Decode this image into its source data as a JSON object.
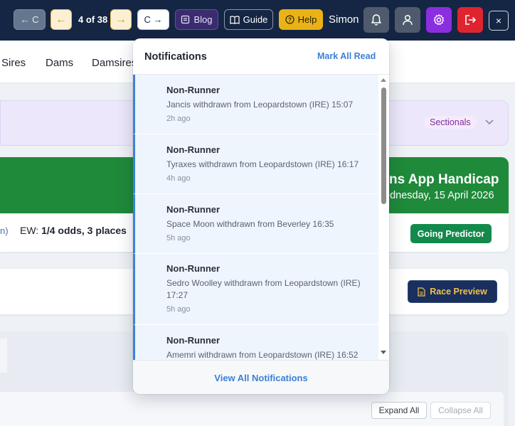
{
  "topbar": {
    "prev_label": "← C",
    "left_arrow": "←",
    "nav_count": "4 of 38",
    "right_arrow": "→",
    "next_label": "C →",
    "blog_label": "Blog",
    "guide_label": "Guide",
    "help_label": "Help",
    "user_name": "Simon",
    "close_label": "×",
    "icons": [
      "bell-icon",
      "user-icon",
      "gear-icon",
      "logout-icon",
      "close-icon"
    ]
  },
  "tabs": [
    "Sires",
    "Dams",
    "Damsires"
  ],
  "sectionals_badge": "Sectionals",
  "race": {
    "title": "ns App Handicap",
    "date": "ednesday, 15 April 2026",
    "meta_start": "n)",
    "ew_label": "EW: ",
    "ew_value": "1/4 odds, 3 places",
    "going_button": "Going Predictor"
  },
  "preview_button": "Race Preview",
  "expand_all": "Expand All",
  "collapse_all": "Collapse All",
  "notifications": {
    "title": "Notifications",
    "mark_all_read": "Mark All Read",
    "view_all": "View All Notifications",
    "items": [
      {
        "title": "Non-Runner",
        "message": "Jancis withdrawn from Leopardstown (IRE) 15:07",
        "time": "2h ago"
      },
      {
        "title": "Non-Runner",
        "message": "Tyraxes withdrawn from Leopardstown (IRE) 16:17",
        "time": "4h ago"
      },
      {
        "title": "Non-Runner",
        "message": "Space Moon withdrawn from Beverley 16:35",
        "time": "5h ago"
      },
      {
        "title": "Non-Runner",
        "message": "Sedro Woolley withdrawn from Leopardstown (IRE) 17:27",
        "time": "5h ago"
      },
      {
        "title": "Non-Runner",
        "message": "Amemri withdrawn from Leopardstown (IRE) 16:52",
        "time": ""
      }
    ]
  },
  "colors": {
    "topbar_bg": "#152644",
    "accent_blue": "#3c7fd6",
    "race_green": "#1f8a3a",
    "going_green": "#138a4b",
    "gear_purple": "#8b2ee0",
    "logout_red": "#e0242f"
  }
}
